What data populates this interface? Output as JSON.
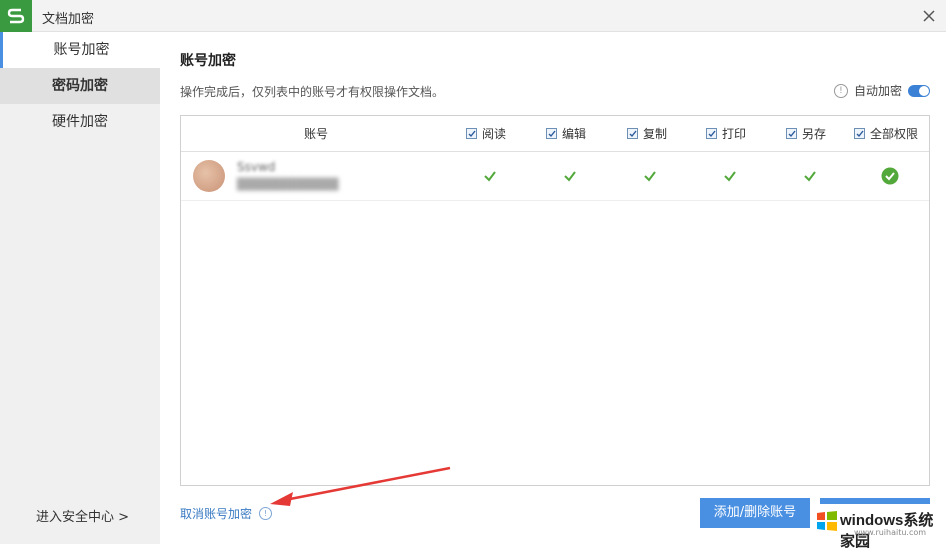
{
  "window": {
    "title": "文档加密"
  },
  "sidebar": {
    "items": [
      {
        "label": "账号加密"
      },
      {
        "label": "密码加密"
      },
      {
        "label": "硬件加密"
      }
    ],
    "security_center": "进入安全中心 >"
  },
  "main": {
    "heading": "账号加密",
    "description": "操作完成后，仅列表中的账号才有权限操作文档。",
    "auto_encrypt": {
      "label": "自动加密",
      "enabled": true
    },
    "table": {
      "columns": [
        "账号",
        "阅读",
        "编辑",
        "复制",
        "打印",
        "另存",
        "全部权限"
      ],
      "rows": [
        {
          "name": "Ssvwd",
          "email": "████████████",
          "permissions": [
            true,
            true,
            true,
            true,
            true,
            true
          ]
        }
      ]
    },
    "cancel_link": "取消账号加密",
    "add_remove_button": "添加/删除账号"
  },
  "watermark": {
    "brand": "windows系统家园",
    "url": "www.ruihaitu.com"
  },
  "colors": {
    "accent": "#4a90e2",
    "check": "#52a83a",
    "logo": "#3a9a3f",
    "arrow": "#e53935"
  }
}
